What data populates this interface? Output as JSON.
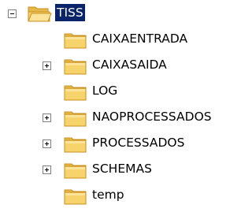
{
  "tree": {
    "root": {
      "label": "TISS",
      "expanded": true,
      "selected": true,
      "icon": "folder-open-icon"
    },
    "children": [
      {
        "label": "CAIXAENTRADA",
        "has_expander": false,
        "icon": "folder-icon"
      },
      {
        "label": "CAIXASAIDA",
        "has_expander": true,
        "icon": "folder-icon"
      },
      {
        "label": "LOG",
        "has_expander": false,
        "icon": "folder-icon"
      },
      {
        "label": "NAOPROCESSADOS",
        "has_expander": true,
        "icon": "folder-icon"
      },
      {
        "label": "PROCESSADOS",
        "has_expander": true,
        "icon": "folder-icon"
      },
      {
        "label": "SCHEMAS",
        "has_expander": true,
        "icon": "folder-icon"
      },
      {
        "label": "temp",
        "has_expander": false,
        "icon": "folder-icon"
      }
    ]
  },
  "colors": {
    "selection_bg": "#0a246a",
    "selection_text": "#ffffff",
    "folder_body": "#f6d36b",
    "folder_shadow": "#d9a93a",
    "expander_border": "#808080"
  }
}
